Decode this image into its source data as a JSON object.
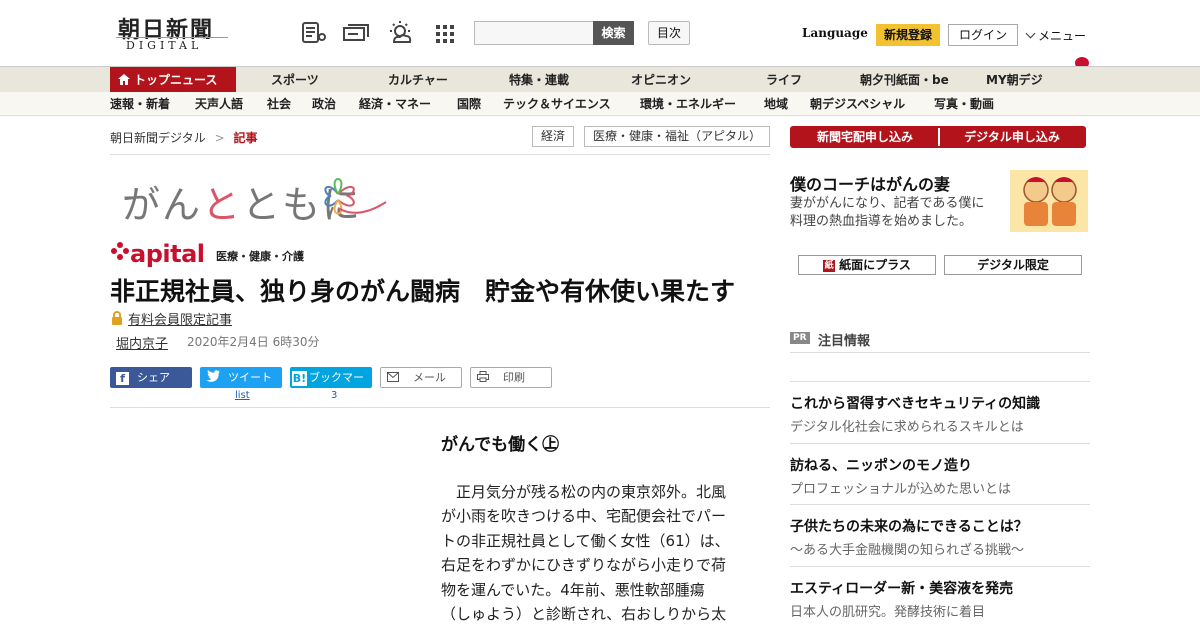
{
  "header": {
    "logo_main": "朝日新聞",
    "logo_sub": "DIGITAL",
    "search_button": "検索",
    "toc_button": "目次",
    "language": "Language",
    "signup": "新規登録",
    "login": "ログイン",
    "menu": "メニュー"
  },
  "nav_primary": [
    "トップニュース",
    "スポーツ",
    "カルチャー",
    "特集・連載",
    "オピニオン",
    "ライフ",
    "朝夕刊紙面・be",
    "MY朝デジ"
  ],
  "nav_secondary": [
    "速報・新着",
    "天声人語",
    "社会",
    "政治",
    "経済・マネー",
    "国際",
    "テック＆サイエンス",
    "環境・エネルギー",
    "地域",
    "朝デジスペシャル",
    "写真・動画"
  ],
  "breadcrumb": {
    "home": "朝日新聞デジタル",
    "sep": ">",
    "current": "記事"
  },
  "tags": [
    "経済",
    "医療・健康・福祉（アピタル）"
  ],
  "series": {
    "banner_a": "がん",
    "banner_b": "と",
    "banner_c": "ともに",
    "apital_logo": "apital",
    "apital_sub": "医療・健康・介護"
  },
  "article": {
    "title": "非正規社員、独り身のがん闘病　貯金や有休使い果たす",
    "paid_label": "有料会員限定記事",
    "author": "堀内京子",
    "date": "2020年2月4日 6時30分",
    "share_label": "シェア",
    "tweet_label": "ツイート",
    "tweet_count": "list",
    "bookmark_label": "ブックマーク",
    "bookmark_count": "3",
    "mail_label": "メール",
    "print_label": "印刷",
    "sub_heading": "がんでも働く㊤",
    "body_lines": [
      "　正月気分が残る松の内の東京郊外。北風",
      "が小雨を吹きつける中、宅配便会社でパー",
      "トの非正規社員として働く女性（61）は、",
      "右足をわずかにひきずりながら小走りで荷",
      "物を運んでいた。4年前、悪性軟部腫瘍",
      "（しゅよう）と診断され、右おしりから太"
    ]
  },
  "sidebar": {
    "btn_newspaper": "新聞宅配申し込み",
    "btn_digital": "デジタル申し込み",
    "coach_title": "僕のコーチはがんの妻",
    "coach_desc_1": "妻ががんになり、記者である僕に",
    "coach_desc_2": "料理の熱血指導を始めました。",
    "btn_paper_plus": "紙面にプラス",
    "btn_digital_only": "デジタル限定",
    "pr_badge": "PR",
    "pr_heading": "注目情報",
    "pr_items": [
      {
        "title": "これから習得すべきセキュリティの知識",
        "desc": "デジタル化社会に求められるスキルとは"
      },
      {
        "title": "訪ねる、ニッポンのモノ造り",
        "desc": "プロフェッショナルが込めた思いとは"
      },
      {
        "title": "子供たちの未来の為にできることは？",
        "desc": "～ある大手金融機関の知られざる挑戦～"
      },
      {
        "title": "エスティローダー新・美容液を発売",
        "desc": "日本人の肌研究。発酵技術に着目"
      }
    ]
  },
  "colors": {
    "brand_red": "#b3131b",
    "signup_yellow": "#f3c230",
    "nav_bg": "#e9e6db",
    "twitter_blue": "#1da1f2",
    "hatena_blue": "#00a4de",
    "facebook_blue": "#3b5998"
  }
}
